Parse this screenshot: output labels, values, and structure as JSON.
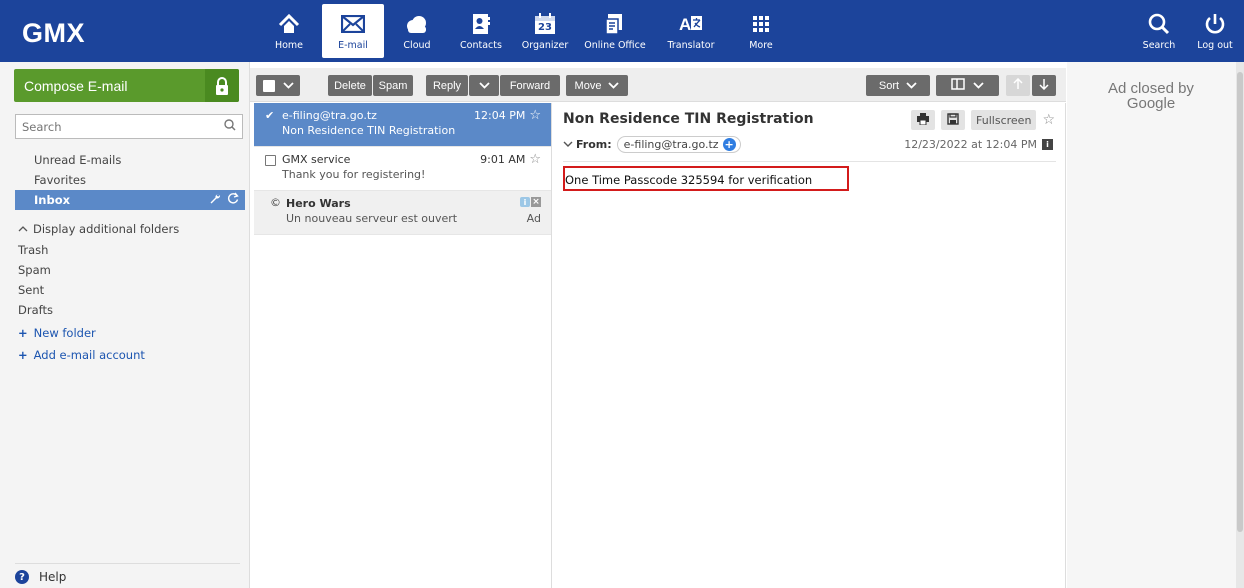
{
  "brand": {
    "logo": "GMX"
  },
  "nav": {
    "items": [
      {
        "label": "Home"
      },
      {
        "label": "E-mail"
      },
      {
        "label": "Cloud"
      },
      {
        "label": "Contacts"
      },
      {
        "label": "Organizer",
        "badge": "23"
      },
      {
        "label": "Online Office"
      },
      {
        "label": "Translator"
      },
      {
        "label": "More"
      }
    ],
    "right": [
      {
        "label": "Search"
      },
      {
        "label": "Log out"
      }
    ]
  },
  "sidebar": {
    "compose_label": "Compose E-mail",
    "search_placeholder": "Search",
    "folders_top": [
      {
        "label": "Unread E-mails"
      },
      {
        "label": "Favorites"
      }
    ],
    "inbox_label": "Inbox",
    "display_additional": "Display additional folders",
    "folders": [
      {
        "label": "Trash"
      },
      {
        "label": "Spam"
      },
      {
        "label": "Sent"
      },
      {
        "label": "Drafts"
      }
    ],
    "new_folder": "New folder",
    "add_account": "Add e-mail account",
    "help": "Help"
  },
  "toolbar": {
    "delete": "Delete",
    "spam": "Spam",
    "reply": "Reply",
    "forward": "Forward",
    "move": "Move",
    "sort": "Sort"
  },
  "messages": [
    {
      "from": "e-filing@tra.go.tz",
      "time": "12:04 PM",
      "subject": "Non Residence TIN Registration",
      "selected": true
    },
    {
      "from": "GMX service",
      "time": "9:01 AM",
      "subject": "Thank you for registering!"
    },
    {
      "from": "Hero Wars",
      "time": "",
      "subject": "Un nouveau serveur est ouvert",
      "ad_label": "Ad"
    }
  ],
  "reader": {
    "subject": "Non Residence TIN Registration",
    "from_label": "From:",
    "from_address": "e-filing@tra.go.tz",
    "date": "12/23/2022 at 12:04 PM",
    "fullscreen": "Fullscreen",
    "body": "One Time Passcode 325594 for verification"
  },
  "ad": {
    "closed_by": "Ad closed by",
    "google": "Google"
  },
  "colors": {
    "topbar": "#1c449b",
    "compose": "#5a9a2c",
    "selected": "#5b89c8",
    "highlight": "#d31b1b"
  }
}
